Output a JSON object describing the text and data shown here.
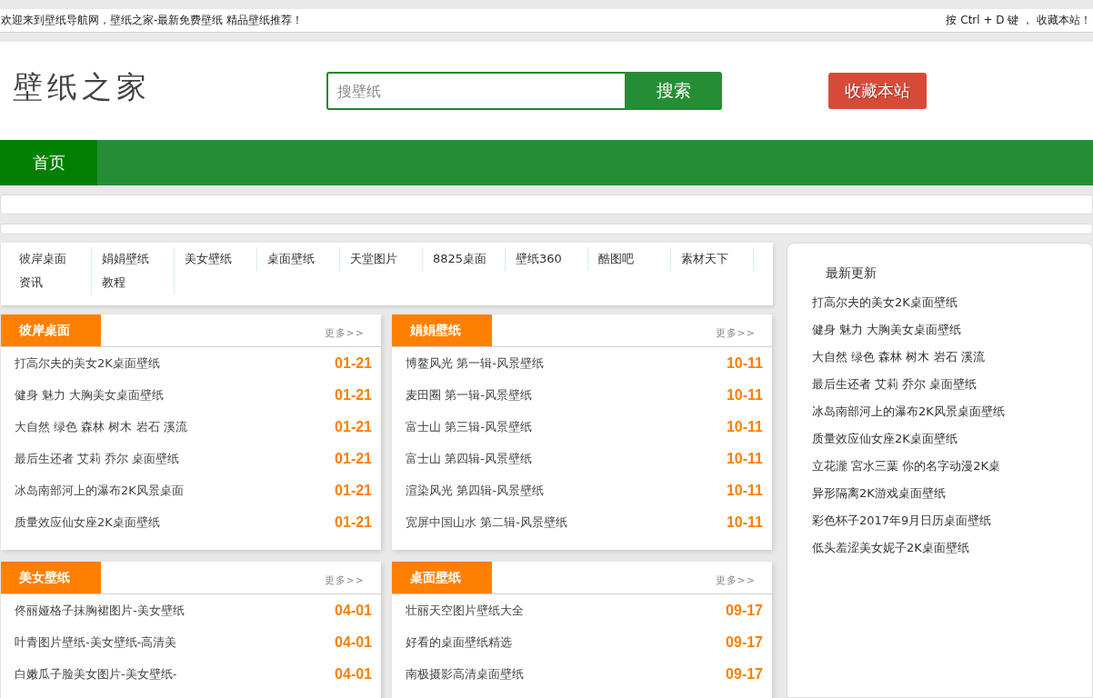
{
  "top_bar": {
    "welcome": "欢迎来到壁纸导航网，壁纸之家-最新免费壁纸 精品壁纸推荐！",
    "bookmark_hint": "按 Ctrl + D 键 ， 收藏本站！"
  },
  "header": {
    "logo": "壁纸之家",
    "search": {
      "placeholder": "搜壁纸",
      "button": "搜索"
    },
    "bookmark_button": "收藏本站"
  },
  "nav": {
    "items": [
      {
        "label": "首页",
        "selected": true
      }
    ]
  },
  "site_links": [
    "彼岸桌面",
    "娟娟壁纸",
    "美女壁纸",
    "桌面壁纸",
    "天堂图片",
    "8825桌面",
    "壁纸360",
    "酷图吧",
    "素材天下",
    "资讯",
    "教程"
  ],
  "sections": [
    {
      "title": "彼岸桌面",
      "more": "更多>>",
      "items": [
        {
          "title": "打高尔夫的美女2K桌面壁纸",
          "date": "01-21"
        },
        {
          "title": "健身 魅力 大胸美女桌面壁纸",
          "date": "01-21"
        },
        {
          "title": "大自然 绿色 森林 树木 岩石 溪流",
          "date": "01-21"
        },
        {
          "title": "最后生还者 艾莉 乔尔 桌面壁纸",
          "date": "01-21"
        },
        {
          "title": "冰岛南部河上的瀑布2K风景桌面",
          "date": "01-21"
        },
        {
          "title": "质量效应仙女座2K桌面壁纸",
          "date": "01-21"
        }
      ]
    },
    {
      "title": "娟娟壁纸",
      "more": "更多>>",
      "items": [
        {
          "title": "博鳌风光 第一辑-风景壁纸",
          "date": "10-11"
        },
        {
          "title": "麦田圈 第一辑-风景壁纸",
          "date": "10-11"
        },
        {
          "title": "富士山 第三辑-风景壁纸",
          "date": "10-11"
        },
        {
          "title": "富士山 第四辑-风景壁纸",
          "date": "10-11"
        },
        {
          "title": "渲染风光 第四辑-风景壁纸",
          "date": "10-11"
        },
        {
          "title": "宽屏中国山水 第二辑-风景壁纸",
          "date": "10-11"
        }
      ]
    },
    {
      "title": "美女壁纸",
      "more": "更多>>",
      "items": [
        {
          "title": "佟丽娅格子抹胸裙图片-美女壁纸",
          "date": "04-01"
        },
        {
          "title": "叶青图片壁纸-美女壁纸-高清美",
          "date": "04-01"
        },
        {
          "title": "白嫩瓜子脸美女图片-美女壁纸-",
          "date": "04-01"
        }
      ]
    },
    {
      "title": "桌面壁纸",
      "more": "更多>>",
      "items": [
        {
          "title": "壮丽天空图片壁纸大全",
          "date": "09-17"
        },
        {
          "title": "好看的桌面壁纸精选",
          "date": "09-17"
        },
        {
          "title": "南极摄影高清桌面壁纸",
          "date": "09-17"
        }
      ]
    }
  ],
  "latest": {
    "title": "最新更新",
    "items": [
      "打高尔夫的美女2K桌面壁纸",
      "健身 魅力 大胸美女桌面壁纸",
      "大自然 绿色 森林 树木 岩石 溪流",
      "最后生还者 艾莉 乔尔 桌面壁纸",
      "冰岛南部河上的瀑布2K风景桌面壁纸",
      "质量效应仙女座2K桌面壁纸",
      "立花瀧 宮水三葉 你的名字动漫2K桌",
      "异形隔离2K游戏桌面壁纸",
      "彩色杯子2017年9月日历桌面壁纸",
      "低头羞涩美女妮子2K桌面壁纸"
    ]
  }
}
